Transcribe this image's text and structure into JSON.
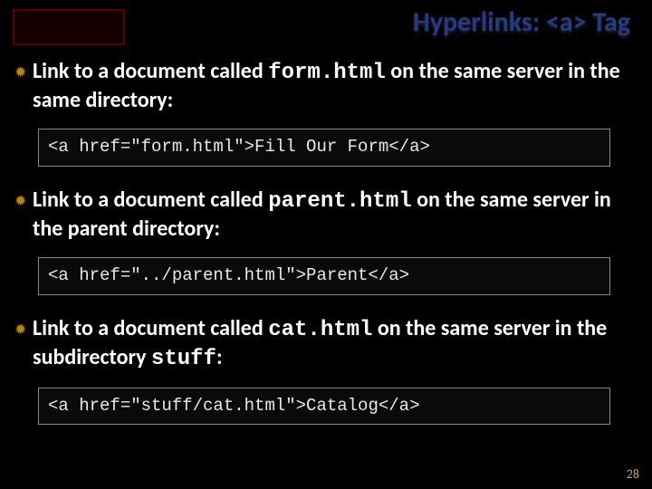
{
  "title": "Hyperlinks: <a> Tag",
  "items": [
    {
      "pre": "Link to a document called ",
      "code": "form.html",
      "post": " on the same server in the same directory:",
      "snippet": "<a href=\"form.html\">Fill Our Form</a>"
    },
    {
      "pre": "Link to a document called ",
      "code": "parent.html",
      "post": " on the same server in the parent directory:",
      "snippet": "<a href=\"../parent.html\">Parent</a>"
    },
    {
      "pre": "Link to a document called ",
      "code": "cat.html",
      "post": " on the same server in the subdirectory ",
      "post_code": "stuff",
      "post_tail": ":",
      "snippet": "<a href=\"stuff/cat.html\">Catalog</a>"
    }
  ],
  "page_number": "28",
  "bullet_glyph": "✹"
}
